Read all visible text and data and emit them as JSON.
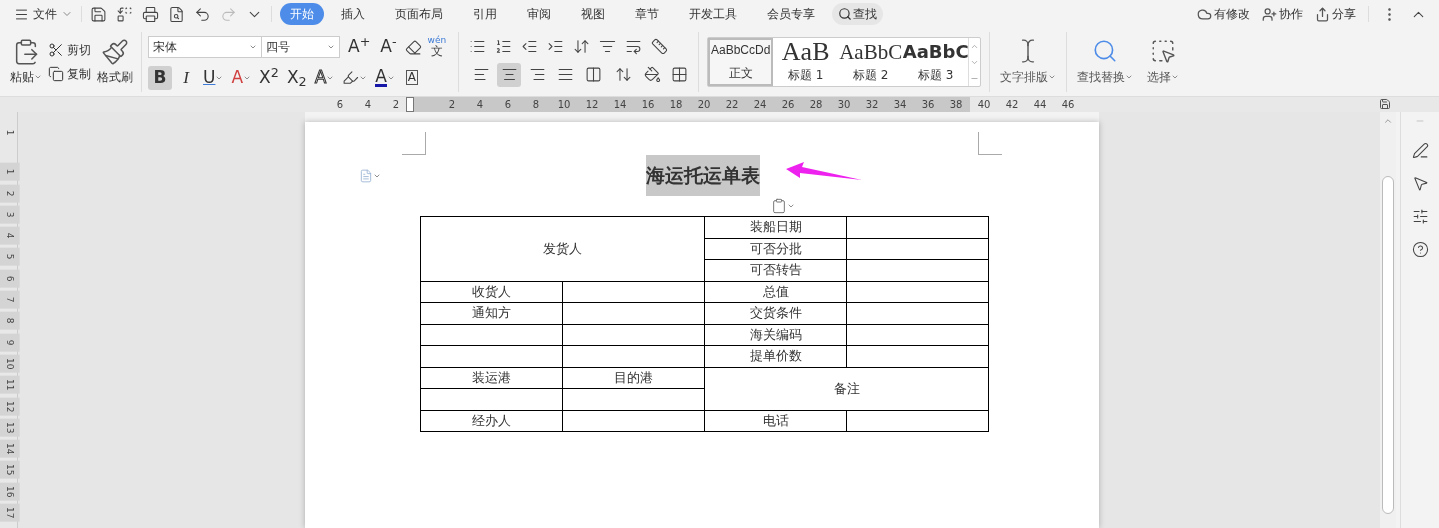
{
  "menu": {
    "file": "文件",
    "tabs": [
      {
        "label": "开始",
        "selected": true
      },
      {
        "label": "插入",
        "selected": false
      },
      {
        "label": "页面布局",
        "selected": false
      },
      {
        "label": "引用",
        "selected": false
      },
      {
        "label": "审阅",
        "selected": false
      },
      {
        "label": "视图",
        "selected": false
      },
      {
        "label": "章节",
        "selected": false
      },
      {
        "label": "开发工具",
        "selected": false
      },
      {
        "label": "会员专享",
        "selected": false
      }
    ],
    "search": "查找",
    "status": "有修改",
    "collab": "协作",
    "share": "分享"
  },
  "ribbon": {
    "paste": "粘贴",
    "cut": "剪切",
    "copy": "复制",
    "format_painter": "格式刷",
    "font": "宋体",
    "size": "四号",
    "font_buttons": [
      {
        "kind": "grow",
        "label": "A$^{+}$"
      },
      {
        "kind": "shrink",
        "label": "A$^{-}$"
      },
      {
        "kind": "eraser"
      },
      {
        "kind": "pinyin",
        "label": "wén",
        "base": "文"
      }
    ],
    "format_buttons": [
      {
        "kind": "bold",
        "label": "B",
        "selected": true
      },
      {
        "kind": "italic",
        "label": "I",
        "selected": false
      },
      {
        "kind": "underline",
        "label": "U",
        "selected": false
      },
      {
        "kind": "strike",
        "label": "A",
        "selected": false
      },
      {
        "kind": "super",
        "label": "X$^{2}$",
        "selected": false
      },
      {
        "kind": "sub",
        "label": "X$_{2}$",
        "selected": false
      },
      {
        "kind": "outline",
        "label": "A",
        "selected": false
      },
      {
        "kind": "highlight",
        "selected": false
      },
      {
        "kind": "fontcolor",
        "label": "A",
        "selected": false
      },
      {
        "kind": "boxed",
        "label": "A",
        "selected": false
      }
    ],
    "align_buttons": [
      {
        "selected": false
      },
      {
        "selected": true
      },
      {
        "selected": false
      },
      {
        "selected": false
      },
      {
        "selected": false
      }
    ],
    "styles": [
      {
        "kind": "body",
        "sample": "AaBbCcDd",
        "label": "正文",
        "selected": true
      },
      {
        "kind": "h1",
        "sample": "AaB",
        "label": "标题 1",
        "selected": false
      },
      {
        "kind": "h2",
        "sample": "AaBbC",
        "label": "标题 2",
        "selected": false
      },
      {
        "kind": "h3",
        "sample": "AaBbC",
        "label": "标题 3",
        "selected": false
      }
    ],
    "text_layout": "文字排版",
    "find_replace": "查找替换",
    "select": "选择"
  },
  "ruler": {
    "numbers": [
      "6",
      "4",
      "2",
      "2",
      "4",
      "6",
      "8",
      "10",
      "12",
      "14",
      "16",
      "18",
      "20",
      "22",
      "24",
      "26",
      "28",
      "30",
      "32",
      "34",
      "36",
      "38",
      "40",
      "42",
      "44",
      "46"
    ],
    "vertical": [
      "1",
      "1",
      "2",
      "3",
      "4",
      "5",
      "6",
      "7",
      "8",
      "9",
      "10",
      "11",
      "12",
      "13",
      "14",
      "15",
      "16",
      "17"
    ]
  },
  "document": {
    "title": {
      "text": "海运托运单表",
      "selected": true
    },
    "table": {
      "rows": [
        [
          {
            "text": "发货人",
            "colspan": 2,
            "rowspan": 3
          },
          {
            "text": "装船日期"
          },
          {}
        ],
        [
          {
            "text": "可否分批"
          },
          {}
        ],
        [
          {
            "text": "可否转告"
          },
          {}
        ],
        [
          {
            "text": "收货人"
          },
          {},
          {
            "text": "总值"
          },
          {}
        ],
        [
          {
            "text": "通知方"
          },
          {},
          {
            "text": "交货条件"
          },
          {}
        ],
        [
          {},
          {},
          {
            "text": "海关编码"
          },
          {}
        ],
        [
          {},
          {},
          {
            "text": "提单价数"
          },
          {}
        ],
        [
          {
            "text": "装运港"
          },
          {
            "text": "目的港"
          },
          {
            "text": "备注",
            "colspan": 2,
            "rowspan": 2
          }
        ],
        [
          {},
          {}
        ],
        [
          {
            "text": "经办人"
          },
          {},
          {
            "text": "电话"
          },
          {}
        ]
      ]
    }
  }
}
